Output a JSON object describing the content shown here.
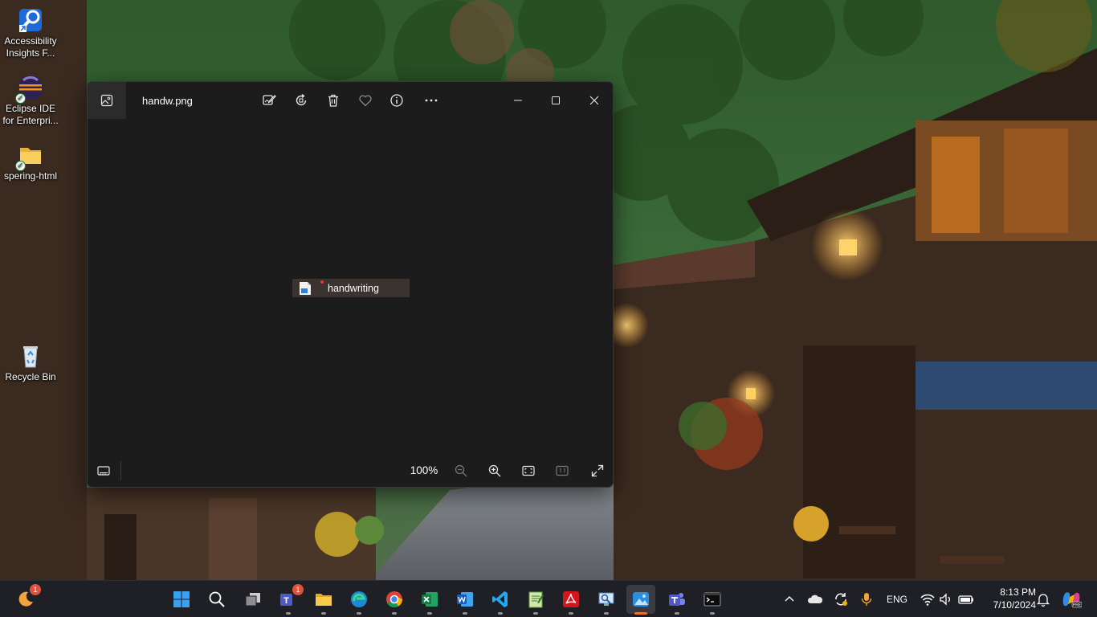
{
  "desktop": {
    "icons": [
      {
        "label": "Accessibility Insights F...",
        "icon": "accessibility-insights-icon"
      },
      {
        "label": "Eclipse IDE for Enterpri...",
        "icon": "eclipse-icon"
      },
      {
        "label": "spering-html",
        "icon": "folder-icon"
      },
      {
        "label": "Recycle Bin",
        "icon": "recycle-bin-icon"
      }
    ]
  },
  "photos_window": {
    "title": "handw.png",
    "toolbar": [
      "edit-icon",
      "rotate-icon",
      "delete-icon",
      "favorite-icon",
      "info-icon",
      "more-icon"
    ],
    "window_controls": [
      "minimize-icon",
      "maximize-icon",
      "close-icon"
    ],
    "drag_item": {
      "label": "handwriting"
    },
    "zoom_level": "100%",
    "bottom_controls": [
      "filmstrip-icon",
      "zoom-out-icon",
      "zoom-in-icon",
      "fit-to-window-icon",
      "actual-size-icon",
      "fullscreen-icon"
    ]
  },
  "taskbar": {
    "apps": [
      {
        "name": "start",
        "icon": "windows-start-icon"
      },
      {
        "name": "search",
        "icon": "search-icon"
      },
      {
        "name": "task-view",
        "icon": "task-view-icon"
      },
      {
        "name": "teams-classic",
        "icon": "teams-icon",
        "badge": "1"
      },
      {
        "name": "file-explorer",
        "icon": "folder-icon"
      },
      {
        "name": "edge",
        "icon": "edge-icon"
      },
      {
        "name": "chrome",
        "icon": "chrome-icon"
      },
      {
        "name": "excel",
        "icon": "excel-icon"
      },
      {
        "name": "word",
        "icon": "word-icon"
      },
      {
        "name": "vscode",
        "icon": "vscode-icon"
      },
      {
        "name": "notepad-plus",
        "icon": "notepad-icon"
      },
      {
        "name": "acrobat",
        "icon": "acrobat-icon"
      },
      {
        "name": "remote-desktop",
        "icon": "remote-desktop-icon"
      },
      {
        "name": "photos",
        "icon": "photos-icon",
        "active": true
      },
      {
        "name": "teams",
        "icon": "teams-new-icon"
      },
      {
        "name": "terminal",
        "icon": "terminal-icon"
      }
    ],
    "weather_badge": "1",
    "language": "ENG",
    "time": "8:13 PM",
    "date": "7/10/2024"
  },
  "colors": {
    "window_bg": "#1c1c1c",
    "taskbar_bg": "#1f2026",
    "active_indicator": "#e8742c",
    "badge": "#e2513a"
  }
}
